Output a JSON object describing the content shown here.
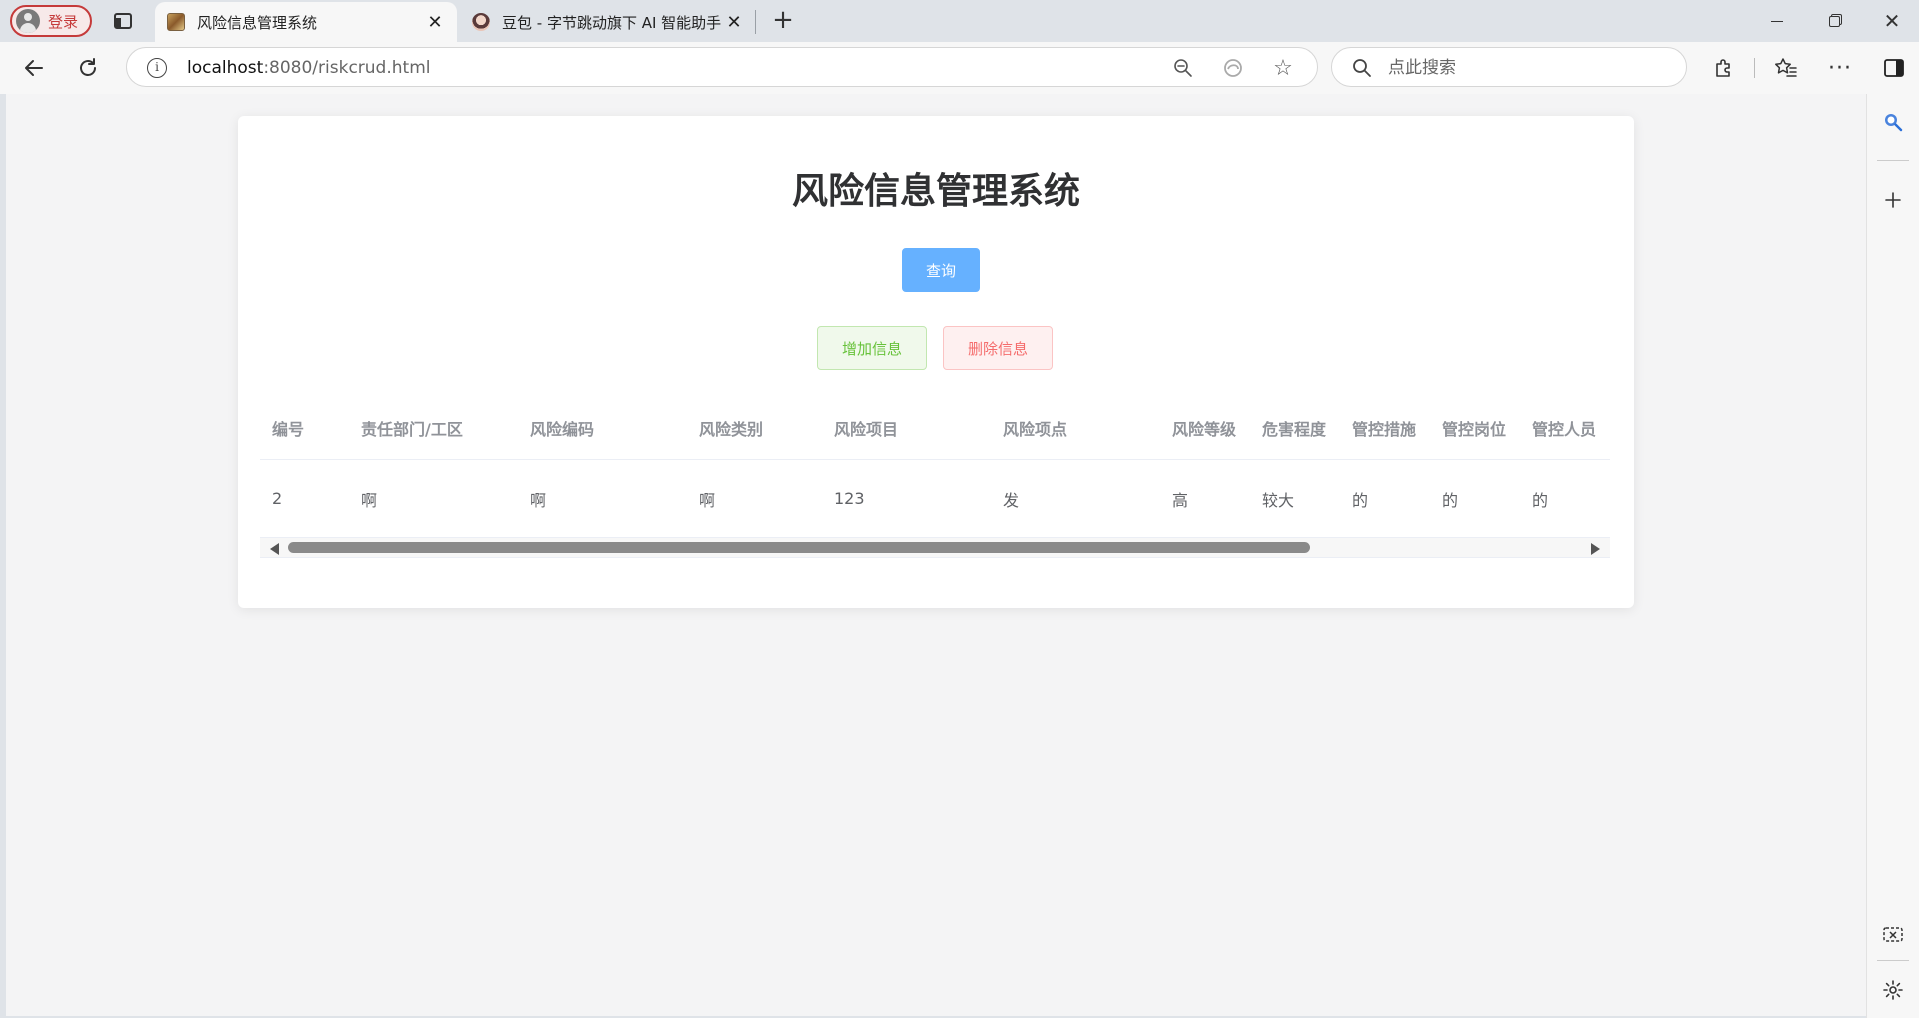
{
  "browser": {
    "profile_label": "登录",
    "tabs": [
      {
        "title": "风险信息管理系统",
        "active": true
      },
      {
        "title": "豆包 - 字节跳动旗下 AI 智能助手",
        "active": false
      }
    ],
    "address": {
      "host": "localhost",
      "rest": ":8080/riskcrud.html"
    },
    "search_placeholder": "点此搜索"
  },
  "page": {
    "title": "风险信息管理系统",
    "buttons": {
      "query": "查询",
      "add": "增加信息",
      "delete": "删除信息"
    },
    "table": {
      "headers": [
        "编号",
        "责任部门/工区",
        "风险编码",
        "风险类别",
        "风险项目",
        "风险项点",
        "风险等级",
        "危害程度",
        "管控措施",
        "管控岗位",
        "管控人员"
      ],
      "rows": [
        [
          "2",
          "啊",
          "啊",
          "啊",
          "123",
          "发",
          "高",
          "较大",
          "的",
          "的",
          "的"
        ]
      ]
    },
    "scroll_position": 0
  },
  "colors": {
    "primary": "#66b1ff",
    "success_text": "#67c23a",
    "success_bg": "#f0f9eb",
    "danger_text": "#f56c6c",
    "danger_bg": "#fef0f0",
    "profile_accent": "#c53a3a"
  },
  "icons": {
    "back": "arrow-left-icon",
    "reload": "reload-icon",
    "info": "info-icon",
    "zoom": "zoom-out-icon",
    "favorite": "star-icon",
    "search": "search-icon",
    "extensions": "puzzle-icon",
    "favorites": "favorites-list-icon",
    "more": "more-icon",
    "sidebar": "sidebar-icon"
  }
}
